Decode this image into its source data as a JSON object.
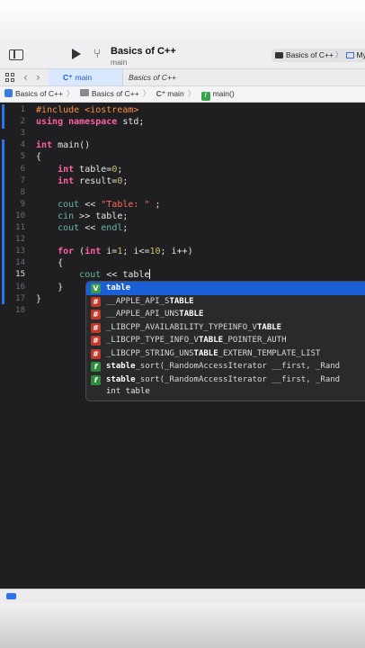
{
  "window": {
    "project_title": "Basics of C++",
    "branch": "main",
    "scheme_label": "Basics of C++",
    "destination_label": "My"
  },
  "tabs": [
    {
      "label": "main",
      "icon": "cpp-file-icon",
      "active": true
    },
    {
      "label": "Basics of C++",
      "icon": "project-icon",
      "active": false
    }
  ],
  "breadcrumb": [
    "Basics of C++",
    "Basics of C++",
    "main",
    "main()"
  ],
  "code": {
    "current_line": 15,
    "line_numbers": [
      "1",
      "2",
      "3",
      "4",
      "5",
      "6",
      "7",
      "8",
      "9",
      "10",
      "11",
      "12",
      "13",
      "14",
      "15",
      "16",
      "17",
      "18"
    ],
    "lines": [
      [
        {
          "t": "#include <iostream>",
          "c": "pp"
        }
      ],
      [
        {
          "t": "using namespace",
          "c": "kw"
        },
        {
          "t": " std;",
          "c": ""
        }
      ],
      [],
      [
        {
          "t": "int",
          "c": "kw"
        },
        {
          "t": " main()",
          "c": ""
        }
      ],
      [
        {
          "t": "{",
          "c": ""
        }
      ],
      [
        {
          "t": "    ",
          "c": ""
        },
        {
          "t": "int",
          "c": "kw"
        },
        {
          "t": " table=",
          "c": ""
        },
        {
          "t": "0",
          "c": "num"
        },
        {
          "t": ";",
          "c": ""
        }
      ],
      [
        {
          "t": "    ",
          "c": ""
        },
        {
          "t": "int",
          "c": "kw"
        },
        {
          "t": " result=",
          "c": ""
        },
        {
          "t": "0",
          "c": "num"
        },
        {
          "t": ";",
          "c": ""
        }
      ],
      [],
      [
        {
          "t": "    ",
          "c": ""
        },
        {
          "t": "cout",
          "c": "fnc"
        },
        {
          "t": " << ",
          "c": ""
        },
        {
          "t": "\"Table: \"",
          "c": "str"
        },
        {
          "t": " ;",
          "c": ""
        }
      ],
      [
        {
          "t": "    ",
          "c": ""
        },
        {
          "t": "cin",
          "c": "fnc"
        },
        {
          "t": " >> table;",
          "c": ""
        }
      ],
      [
        {
          "t": "    ",
          "c": ""
        },
        {
          "t": "cout",
          "c": "fnc"
        },
        {
          "t": " << ",
          "c": ""
        },
        {
          "t": "endl",
          "c": "fnc"
        },
        {
          "t": ";",
          "c": ""
        }
      ],
      [],
      [
        {
          "t": "    ",
          "c": ""
        },
        {
          "t": "for",
          "c": "kw"
        },
        {
          "t": " (",
          "c": ""
        },
        {
          "t": "int",
          "c": "kw"
        },
        {
          "t": " i=",
          "c": ""
        },
        {
          "t": "1",
          "c": "num"
        },
        {
          "t": "; i<=",
          "c": ""
        },
        {
          "t": "10",
          "c": "num"
        },
        {
          "t": "; i++)",
          "c": ""
        }
      ],
      [
        {
          "t": "    {",
          "c": ""
        }
      ],
      [
        {
          "t": "        ",
          "c": ""
        },
        {
          "t": "cout",
          "c": "fnc"
        },
        {
          "t": " << table",
          "c": ""
        },
        {
          "t": "|",
          "c": "cursor"
        }
      ],
      [
        {
          "t": "    }",
          "c": ""
        }
      ],
      [
        {
          "t": "}",
          "c": ""
        }
      ],
      []
    ]
  },
  "completion": {
    "items": [
      {
        "badge": "V",
        "kind": "variable",
        "pre": "",
        "match": "table",
        "post": ""
      },
      {
        "badge": "#",
        "kind": "macro",
        "pre": "__APPLE_API_S",
        "match": "TABLE",
        "post": ""
      },
      {
        "badge": "#",
        "kind": "macro",
        "pre": "__APPLE_API_UNS",
        "match": "TABLE",
        "post": ""
      },
      {
        "badge": "#",
        "kind": "macro",
        "pre": "_LIBCPP_AVAILABILITY_TYPEINFO_V",
        "match": "TABLE",
        "post": ""
      },
      {
        "badge": "#",
        "kind": "macro",
        "pre": "_LIBCPP_TYPE_INFO_V",
        "match": "TABLE",
        "post": "_POINTER_AUTH"
      },
      {
        "badge": "#",
        "kind": "macro",
        "pre": "_LIBCPP_STRING_UNS",
        "match": "TABLE",
        "post": "_EXTERN_TEMPLATE_LIST"
      },
      {
        "badge": "f",
        "kind": "function",
        "pre": "",
        "match": "stable",
        "post": "_sort(_RandomAccessIterator __first, _Rand"
      },
      {
        "badge": "f",
        "kind": "function",
        "pre": "",
        "match": "stable",
        "post": "_sort(_RandomAccessIterator __first, _Rand"
      }
    ],
    "detail": "int table"
  }
}
